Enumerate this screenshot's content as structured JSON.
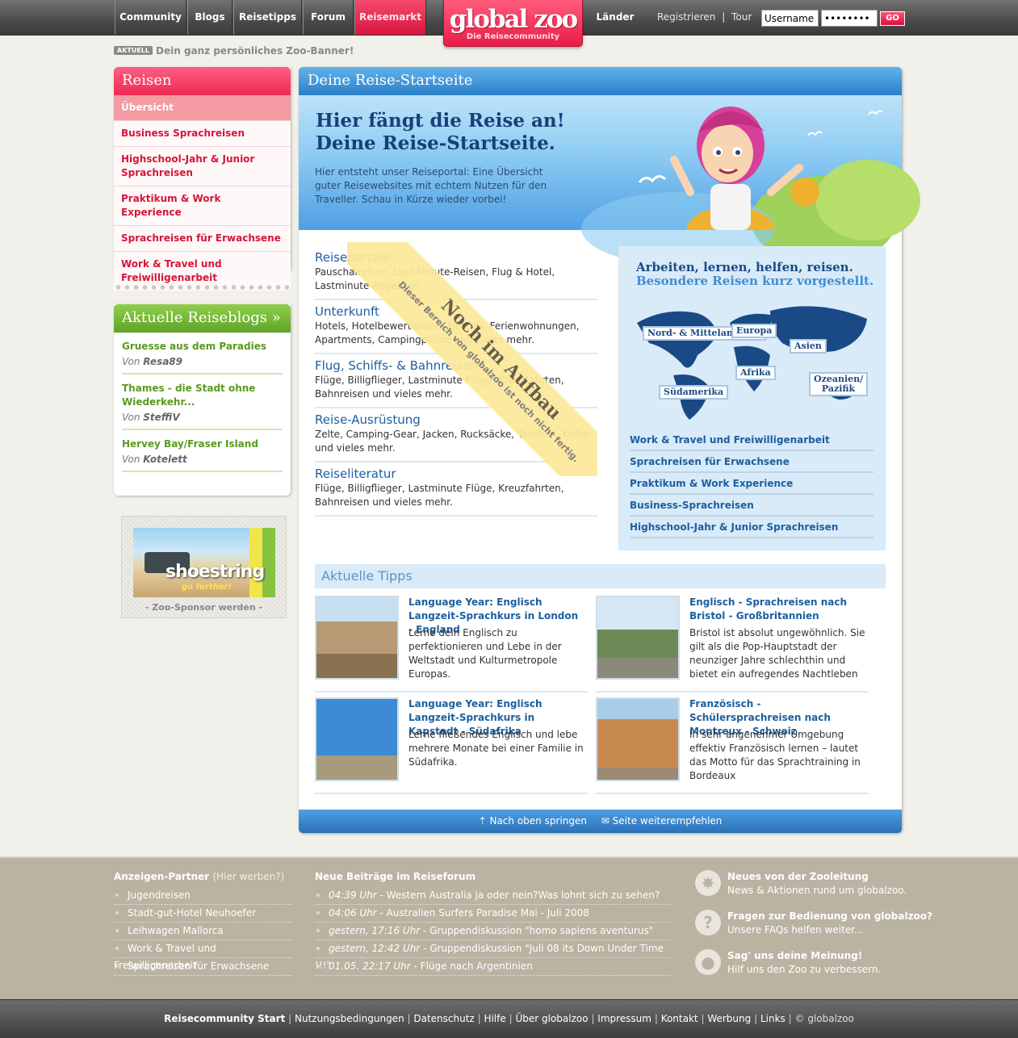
{
  "nav": {
    "items": [
      "Community",
      "Blogs",
      "Reisetipps",
      "Forum",
      "Reisemarkt"
    ],
    "laender": "Länder",
    "register": "Registrieren",
    "separator": "|",
    "tour": "Tour",
    "username_value": "Username",
    "password_value": "••••••••",
    "go": "GO"
  },
  "logo": {
    "name": "global zoo",
    "sub": "Die Reisecommunity"
  },
  "aktuell": {
    "tag": "AKTUELL",
    "text": "Dein ganz persönliches Zoo-Banner!"
  },
  "sidebar": {
    "title": "Reisen",
    "items": [
      "Übersicht",
      "Business Sprachreisen",
      "Highschool-Jahr & Junior Sprachreisen",
      "Praktikum & Work Experience",
      "Sprachreisen für Erwachsene",
      "Work & Travel und Freiwilligenarbeit"
    ]
  },
  "blogs": {
    "title": "Aktuelle Reiseblogs »",
    "items": [
      {
        "title": "Gruesse aus dem Paradies",
        "by": "Von",
        "author": "Resa89"
      },
      {
        "title": "Thames - die Stadt ohne Wiederkehr...",
        "by": "Von",
        "author": "SteffiV"
      },
      {
        "title": "Hervey Bay/Fraser Island",
        "by": "Von",
        "author": "Kotelett"
      }
    ]
  },
  "sponsor": {
    "brand": "shoestring",
    "slogan": "go further!",
    "caption": "- Zoo-Sponsor werden -"
  },
  "main": {
    "title": "Deine Reise-Startseite",
    "hero_h1_line1": "Hier fängt die Reise an!",
    "hero_h1_line2": "Deine Reise-Startseite.",
    "hero_text": "Hier entsteht unser Reiseportal: Eine Übersicht guter Reisewebsites mit echtem Nutzen für den Traveller. Schau in Kürze wieder vorbei!",
    "categories": [
      {
        "title": "Reiseportale",
        "desc": "Pauschalreisen, Last-Minute-Reisen, Flug & Hotel, Lastminute-Angebote"
      },
      {
        "title": "Unterkunft",
        "desc": "Hotels, Hotelbewertungen, Hostels, Ferienwohnungen, Apartments, Campingplätze und vieles mehr."
      },
      {
        "title": "Flug, Schiffs- & Bahnreisen",
        "desc": "Flüge, Billigflieger, Lastminute Flüge, Kreuzfahrten, Bahnreisen und vieles mehr."
      },
      {
        "title": "Reise-Ausrüstung",
        "desc": "Zelte, Camping-Gear, Jacken, Rucksäcke, Taschen, Koffer und vieles mehr."
      },
      {
        "title": "Reiseliteratur",
        "desc": "Flüge, Billigflieger, Lastminute Flüge, Kreuzfahrten, Bahnreisen und vieles mehr."
      }
    ],
    "ribbon_title": "Noch im Aufbau",
    "ribbon_sub": "Dieser Bereich von globalzoo ist noch nicht fertig.",
    "world_title1": "Arbeiten, lernen, helfen, reisen.",
    "world_title2": "Besondere Reisen kurz vorgestellt.",
    "continents": [
      "Nord- & Mittelamerika",
      "Europa",
      "Asien",
      "Afrika",
      "Südamerika",
      "Ozeanien/ Pazifik"
    ],
    "world_links": [
      "Work & Travel und Freiwilligenarbeit",
      "Sprachreisen für Erwachsene",
      "Praktikum & Work Experience",
      "Business-Sprachreisen",
      "Highschool-Jahr & Junior Sprachreisen"
    ],
    "tipps_title": "Aktuelle Tipps",
    "tipps": [
      {
        "title": "Language Year: Englisch Langzeit-Sprachkurs in London - England",
        "desc": "Lerne dein Englisch zu perfektionieren und Lebe in der Weltstadt und Kulturmetropole Europas."
      },
      {
        "title": "Englisch - Sprachreisen nach Bristol - Großbritannien",
        "desc": "Bristol ist absolut ungewöhnlich. Sie gilt als die Pop-Hauptstadt der neunziger Jahre schlechthin und bietet ein aufregendes Nachtleben"
      },
      {
        "title": "Language Year: Englisch Langzeit-Sprachkurs in Kapstadt - Südafrika",
        "desc": "Lerne fließendes Englisch und lebe mehrere Monate bei einer Familie in Südafrika."
      },
      {
        "title": "Französisch - Schülersprachreisen nach Montreux - Schweiz",
        "desc": "In sehr angenehmer Umgebung effektiv Französisch lernen – lautet das Motto für das Sprachtraining in Bordeaux"
      }
    ],
    "footer_top": "Nach oben springen",
    "footer_recommend": "Seite weiterempfehlen"
  },
  "footer": {
    "partners_title": "Anzeigen-Partner",
    "partners_hint": "(Hier werben?)",
    "partners": [
      "Jugendreisen",
      "Stadt-gut-Hotel Neuhoefer",
      "Leihwagen Mallorca",
      "Work & Travel und Freiwilligenarbeit",
      "Sprachreisen für Erwachsene"
    ],
    "forum_title": "Neue Beiträge im Reiseforum",
    "forum": [
      {
        "time": "04:39 Uhr",
        "text": " - Western Australia ja oder nein?Was lohnt sich zu sehen?"
      },
      {
        "time": "04:06 Uhr",
        "text": " - Australien Surfers Paradise Mai - Juli 2008"
      },
      {
        "time": "gestern, 17:16 Uhr",
        "text": " - Gruppendiskussion \"homo sapiens aventurus\""
      },
      {
        "time": "gestern, 12:42 Uhr",
        "text": " - Gruppendiskussion \"Juli 08 its Down Under Time !!!\""
      },
      {
        "time": "01.05. 22:17 Uhr",
        "text": " - Flüge nach Argentinien"
      }
    ],
    "info": [
      {
        "title": "Neues von der Zooleitung",
        "text": "News & Aktionen rund um globalzoo."
      },
      {
        "title": "Fragen zur Bedienung von globalzoo?",
        "text": "Unsere FAQs helfen weiter..."
      },
      {
        "title": "Sag' uns deine Meinung!",
        "text": "Hilf uns den Zoo zu verbessern."
      }
    ]
  },
  "bottom": {
    "start": "Reisecommunity Start",
    "links": [
      "Nutzungsbedingungen",
      "Datenschutz",
      "Hilfe",
      "Über globalzoo",
      "Impressum",
      "Kontakt",
      "Werbung",
      "Links"
    ],
    "copyright": "© globalzoo"
  },
  "colors": {
    "brand_pink": "#ee2a53",
    "brand_blue": "#2b7fc8",
    "green": "#5fa328"
  }
}
